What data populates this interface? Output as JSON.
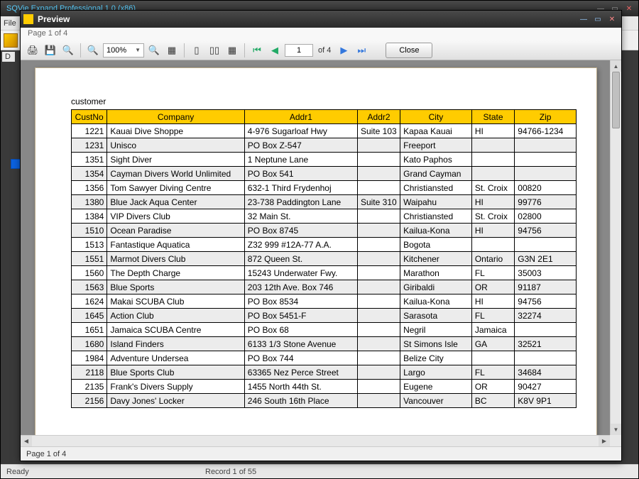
{
  "outer": {
    "title": "SQVie Expand Professional 1.0 (x86)",
    "menubar": "File",
    "leftlabel": "D",
    "status_ready": "Ready",
    "status_record": "Record 1 of 55"
  },
  "preview": {
    "title": "Preview",
    "page_label_top": "Page 1 of 4",
    "zoom": "100%",
    "page_current": "1",
    "page_total": "of 4",
    "close_label": "Close",
    "status": "Page 1 of 4"
  },
  "report": {
    "title": "customer",
    "headers": [
      "CustNo",
      "Company",
      "Addr1",
      "Addr2",
      "City",
      "State",
      "Zip"
    ],
    "rows": [
      [
        "1221",
        "Kauai Dive Shoppe",
        "4-976 Sugarloaf Hwy",
        "Suite 103",
        "Kapaa Kauai",
        "HI",
        "94766-1234"
      ],
      [
        "1231",
        "Unisco",
        "PO Box Z-547",
        "",
        "Freeport",
        "",
        ""
      ],
      [
        "1351",
        "Sight Diver",
        "1 Neptune Lane",
        "",
        "Kato Paphos",
        "",
        ""
      ],
      [
        "1354",
        "Cayman Divers World Unlimited",
        "PO Box 541",
        "",
        "Grand Cayman",
        "",
        ""
      ],
      [
        "1356",
        "Tom Sawyer Diving Centre",
        "632-1 Third Frydenhoj",
        "",
        "Christiansted",
        "St. Croix",
        "00820"
      ],
      [
        "1380",
        "Blue Jack Aqua Center",
        "23-738 Paddington Lane",
        "Suite 310",
        "Waipahu",
        "HI",
        "99776"
      ],
      [
        "1384",
        "VIP Divers Club",
        "32 Main St.",
        "",
        "Christiansted",
        "St. Croix",
        "02800"
      ],
      [
        "1510",
        "Ocean Paradise",
        "PO Box 8745",
        "",
        "Kailua-Kona",
        "HI",
        "94756"
      ],
      [
        "1513",
        "Fantastique Aquatica",
        "Z32 999 #12A-77 A.A.",
        "",
        "Bogota",
        "",
        ""
      ],
      [
        "1551",
        "Marmot Divers Club",
        "872 Queen St.",
        "",
        "Kitchener",
        "Ontario",
        "G3N 2E1"
      ],
      [
        "1560",
        "The Depth Charge",
        "15243 Underwater Fwy.",
        "",
        "Marathon",
        "FL",
        "35003"
      ],
      [
        "1563",
        "Blue Sports",
        "203 12th Ave. Box 746",
        "",
        "Giribaldi",
        "OR",
        "91187"
      ],
      [
        "1624",
        "Makai SCUBA Club",
        "PO Box 8534",
        "",
        "Kailua-Kona",
        "HI",
        "94756"
      ],
      [
        "1645",
        "Action Club",
        "PO Box 5451-F",
        "",
        "Sarasota",
        "FL",
        "32274"
      ],
      [
        "1651",
        "Jamaica SCUBA Centre",
        "PO Box 68",
        "",
        "Negril",
        "Jamaica",
        ""
      ],
      [
        "1680",
        "Island Finders",
        "6133 1/3 Stone Avenue",
        "",
        "St Simons Isle",
        "GA",
        "32521"
      ],
      [
        "1984",
        "Adventure Undersea",
        "PO Box 744",
        "",
        "Belize City",
        "",
        ""
      ],
      [
        "2118",
        "Blue Sports Club",
        "63365 Nez Perce Street",
        "",
        "Largo",
        "FL",
        "34684"
      ],
      [
        "2135",
        "Frank's Divers Supply",
        "1455 North 44th St.",
        "",
        "Eugene",
        "OR",
        "90427"
      ],
      [
        "2156",
        "Davy Jones' Locker",
        "246 South 16th Place",
        "",
        "Vancouver",
        "BC",
        "K8V 9P1"
      ]
    ]
  }
}
